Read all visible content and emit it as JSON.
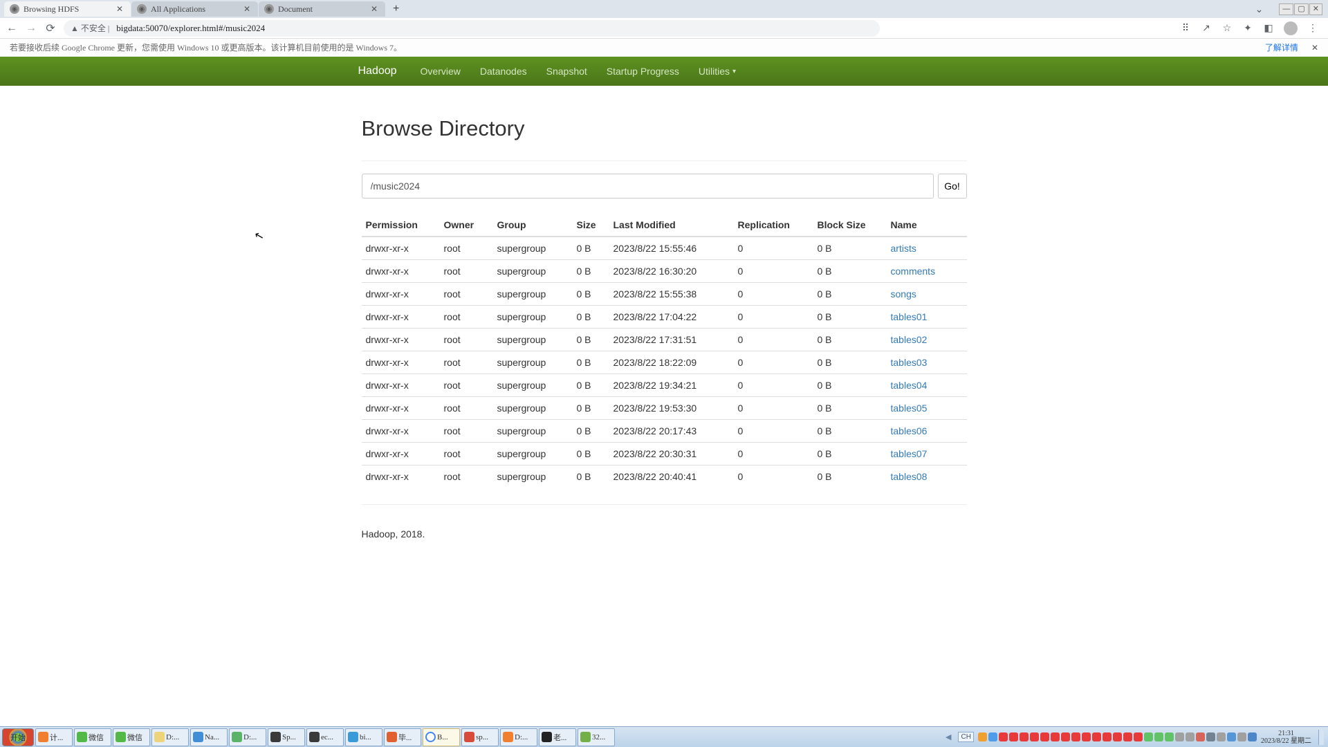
{
  "browser": {
    "tabs": [
      {
        "title": "Browsing HDFS",
        "active": true
      },
      {
        "title": "All Applications",
        "active": false
      },
      {
        "title": "Document",
        "active": false
      }
    ],
    "url_warn": "▲ 不安全 |",
    "url": "bigdata:50070/explorer.html#/music2024",
    "info_msg": "若要接收后续 Google Chrome 更新，您需使用 Windows 10 或更高版本。该计算机目前使用的是 Windows 7。",
    "info_link": "了解详情"
  },
  "nav": {
    "brand": "Hadoop",
    "items": [
      "Overview",
      "Datanodes",
      "Snapshot",
      "Startup Progress"
    ],
    "utilities": "Utilities"
  },
  "page": {
    "title": "Browse Directory",
    "path": "/music2024",
    "go_label": "Go!",
    "footer": "Hadoop, 2018."
  },
  "table": {
    "headers": {
      "permission": "Permission",
      "owner": "Owner",
      "group": "Group",
      "size": "Size",
      "last_modified": "Last Modified",
      "replication": "Replication",
      "block_size": "Block Size",
      "name": "Name"
    },
    "rows": [
      {
        "perm": "drwxr-xr-x",
        "owner": "root",
        "group": "supergroup",
        "size": "0 B",
        "mtime": "2023/8/22 15:55:46",
        "rep": "0",
        "bs": "0 B",
        "name": "artists"
      },
      {
        "perm": "drwxr-xr-x",
        "owner": "root",
        "group": "supergroup",
        "size": "0 B",
        "mtime": "2023/8/22 16:30:20",
        "rep": "0",
        "bs": "0 B",
        "name": "comments"
      },
      {
        "perm": "drwxr-xr-x",
        "owner": "root",
        "group": "supergroup",
        "size": "0 B",
        "mtime": "2023/8/22 15:55:38",
        "rep": "0",
        "bs": "0 B",
        "name": "songs"
      },
      {
        "perm": "drwxr-xr-x",
        "owner": "root",
        "group": "supergroup",
        "size": "0 B",
        "mtime": "2023/8/22 17:04:22",
        "rep": "0",
        "bs": "0 B",
        "name": "tables01"
      },
      {
        "perm": "drwxr-xr-x",
        "owner": "root",
        "group": "supergroup",
        "size": "0 B",
        "mtime": "2023/8/22 17:31:51",
        "rep": "0",
        "bs": "0 B",
        "name": "tables02"
      },
      {
        "perm": "drwxr-xr-x",
        "owner": "root",
        "group": "supergroup",
        "size": "0 B",
        "mtime": "2023/8/22 18:22:09",
        "rep": "0",
        "bs": "0 B",
        "name": "tables03"
      },
      {
        "perm": "drwxr-xr-x",
        "owner": "root",
        "group": "supergroup",
        "size": "0 B",
        "mtime": "2023/8/22 19:34:21",
        "rep": "0",
        "bs": "0 B",
        "name": "tables04"
      },
      {
        "perm": "drwxr-xr-x",
        "owner": "root",
        "group": "supergroup",
        "size": "0 B",
        "mtime": "2023/8/22 19:53:30",
        "rep": "0",
        "bs": "0 B",
        "name": "tables05"
      },
      {
        "perm": "drwxr-xr-x",
        "owner": "root",
        "group": "supergroup",
        "size": "0 B",
        "mtime": "2023/8/22 20:17:43",
        "rep": "0",
        "bs": "0 B",
        "name": "tables06"
      },
      {
        "perm": "drwxr-xr-x",
        "owner": "root",
        "group": "supergroup",
        "size": "0 B",
        "mtime": "2023/8/22 20:30:31",
        "rep": "0",
        "bs": "0 B",
        "name": "tables07"
      },
      {
        "perm": "drwxr-xr-x",
        "owner": "root",
        "group": "supergroup",
        "size": "0 B",
        "mtime": "2023/8/22 20:40:41",
        "rep": "0",
        "bs": "0 B",
        "name": "tables08"
      }
    ]
  },
  "taskbar": {
    "start": "开始",
    "items": [
      {
        "label": "计...",
        "color": "#f08030"
      },
      {
        "label": "微信",
        "color": "#52b848"
      },
      {
        "label": "微信",
        "color": "#52b848"
      },
      {
        "label": "D:...",
        "color": "#edd37a"
      },
      {
        "label": "Na...",
        "color": "#418ed6"
      },
      {
        "label": "D:...",
        "color": "#5bb36a"
      },
      {
        "label": "Sp...",
        "color": "#3a3a3a"
      },
      {
        "label": "ec...",
        "color": "#3a3a3a"
      },
      {
        "label": "bi...",
        "color": "#3a99d8"
      },
      {
        "label": "毕...",
        "color": "#e06030"
      },
      {
        "label": "B...",
        "color": "#fff",
        "active": true,
        "iconring": true
      },
      {
        "label": "sp...",
        "color": "#d84b3a"
      },
      {
        "label": "D:...",
        "color": "#f08030"
      },
      {
        "label": "老...",
        "color": "#222"
      },
      {
        "label": "32...",
        "color": "#74b04a"
      }
    ],
    "lang": "CH",
    "tray_icons": [
      "#f0a030",
      "#4f9de8",
      "#e83a3a",
      "#e83a3a",
      "#e83a3a",
      "#e83a3a",
      "#e83a3a",
      "#e83a3a",
      "#e83a3a",
      "#e83a3a",
      "#e83a3a",
      "#e83a3a",
      "#e83a3a",
      "#e83a3a",
      "#e83a3a",
      "#e83a3a",
      "#62c267",
      "#62c267",
      "#62c267",
      "#a0a0a0",
      "#a0a0a0",
      "#d6655a",
      "#738393",
      "#a0a0a0",
      "#5695d6",
      "#a0a0a0",
      "#4e86c7"
    ],
    "time": "21:31",
    "date": "2023/8/22 星期二"
  }
}
